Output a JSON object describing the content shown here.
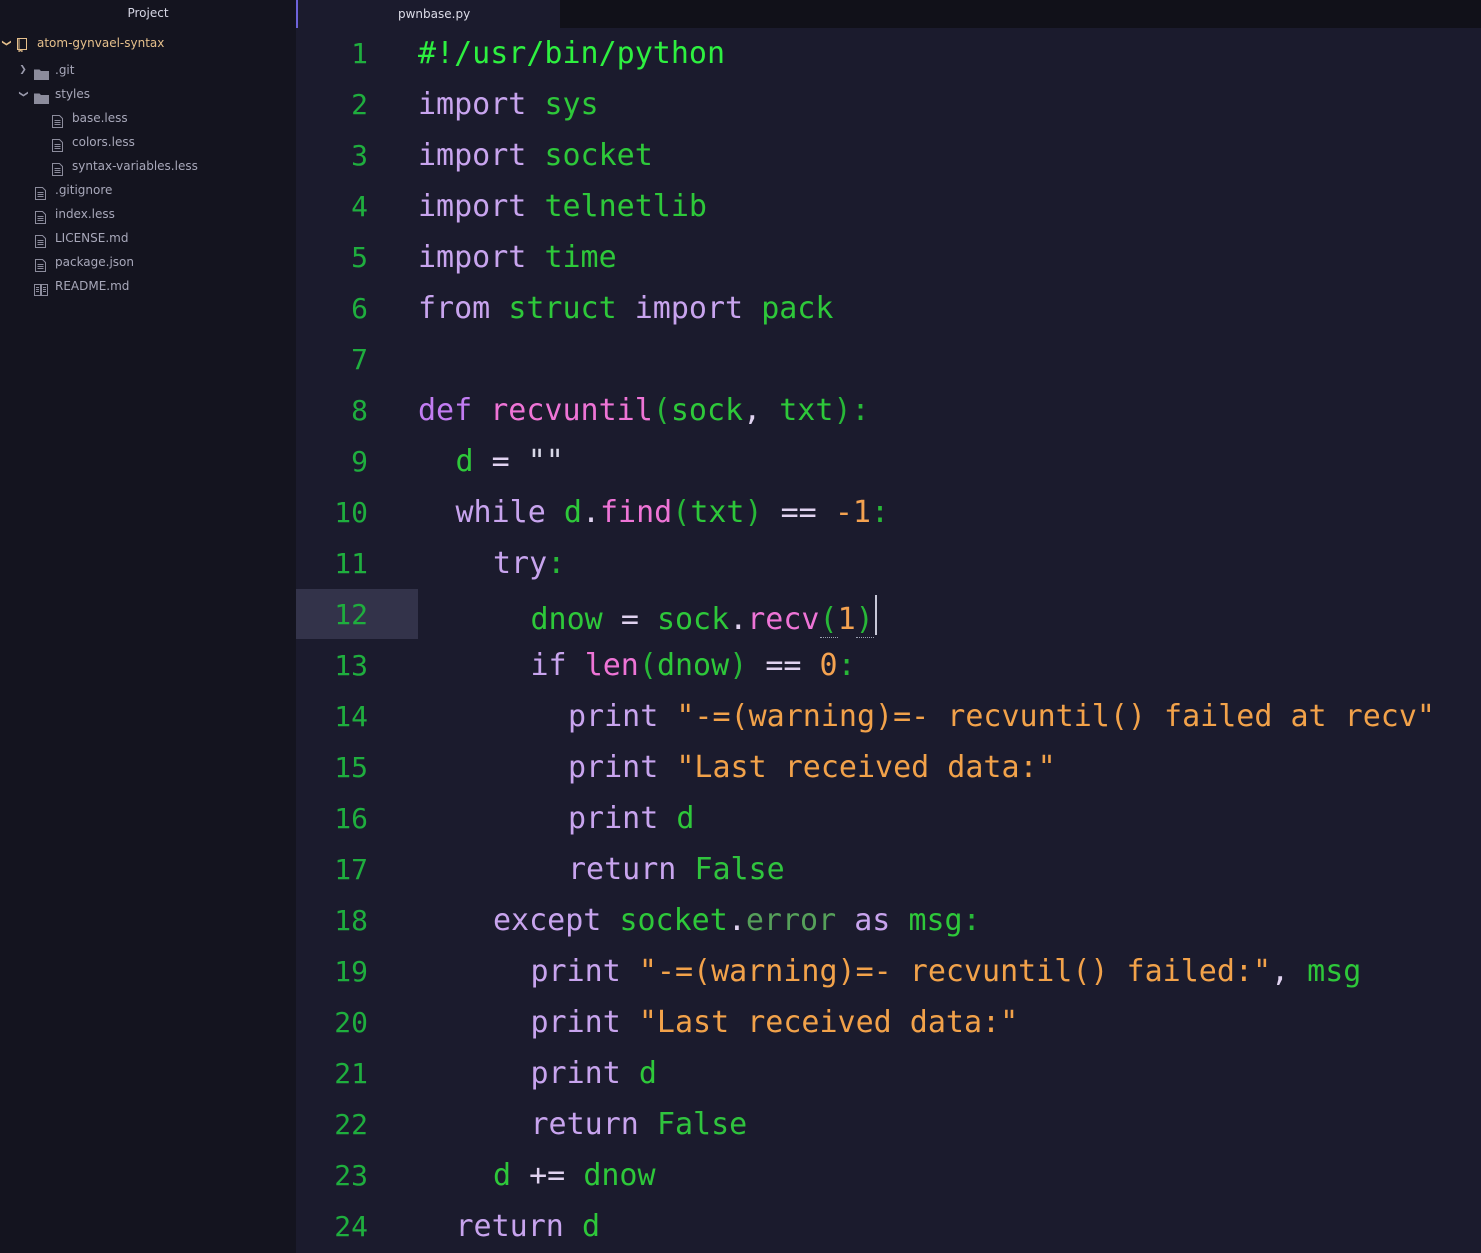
{
  "sidebar": {
    "title": "Project",
    "root": {
      "label": "atom-gynvael-syntax",
      "icon": "repo-icon",
      "expanded": true
    },
    "items": [
      {
        "label": ".git",
        "type": "folder",
        "depth": 1,
        "expanded": false
      },
      {
        "label": "styles",
        "type": "folder",
        "depth": 1,
        "expanded": true
      },
      {
        "label": "base.less",
        "type": "file",
        "depth": 2
      },
      {
        "label": "colors.less",
        "type": "file",
        "depth": 2
      },
      {
        "label": "syntax-variables.less",
        "type": "file",
        "depth": 2
      },
      {
        "label": ".gitignore",
        "type": "file",
        "depth": 1
      },
      {
        "label": "index.less",
        "type": "file",
        "depth": 1
      },
      {
        "label": "LICENSE.md",
        "type": "file",
        "depth": 1
      },
      {
        "label": "package.json",
        "type": "file",
        "depth": 1
      },
      {
        "label": "README.md",
        "type": "book",
        "depth": 1
      }
    ]
  },
  "editor": {
    "active_tab": "pwnbase.py",
    "cursor_line": 12,
    "lines": [
      {
        "n": "1",
        "indent": 0,
        "tokens": [
          [
            "she",
            "#!/usr/bin/python"
          ]
        ]
      },
      {
        "n": "2",
        "indent": 0,
        "tokens": [
          [
            "kw",
            "import"
          ],
          [
            "txt",
            " "
          ],
          [
            "id",
            "sys"
          ]
        ]
      },
      {
        "n": "3",
        "indent": 0,
        "tokens": [
          [
            "kw",
            "import"
          ],
          [
            "txt",
            " "
          ],
          [
            "id",
            "socket"
          ]
        ]
      },
      {
        "n": "4",
        "indent": 0,
        "tokens": [
          [
            "kw",
            "import"
          ],
          [
            "txt",
            " "
          ],
          [
            "id",
            "telnetlib"
          ]
        ]
      },
      {
        "n": "5",
        "indent": 0,
        "tokens": [
          [
            "kw",
            "import"
          ],
          [
            "txt",
            " "
          ],
          [
            "id",
            "time"
          ]
        ]
      },
      {
        "n": "6",
        "indent": 0,
        "tokens": [
          [
            "kw",
            "from"
          ],
          [
            "txt",
            " "
          ],
          [
            "id",
            "struct"
          ],
          [
            "txt",
            " "
          ],
          [
            "kw",
            "import"
          ],
          [
            "txt",
            " "
          ],
          [
            "id",
            "pack"
          ]
        ]
      },
      {
        "n": "7",
        "indent": 0,
        "tokens": []
      },
      {
        "n": "8",
        "indent": 0,
        "tokens": [
          [
            "kw2",
            "def"
          ],
          [
            "txt",
            " "
          ],
          [
            "fn",
            "recvuntil"
          ],
          [
            "pun",
            "("
          ],
          [
            "id",
            "sock"
          ],
          [
            "op",
            ","
          ],
          [
            "txt",
            " "
          ],
          [
            "id",
            "txt"
          ],
          [
            "pun",
            "):"
          ]
        ]
      },
      {
        "n": "9",
        "indent": 1,
        "tokens": [
          [
            "id",
            "d"
          ],
          [
            "txt",
            " "
          ],
          [
            "op",
            "="
          ],
          [
            "txt",
            " "
          ],
          [
            "txt",
            "\"\""
          ]
        ]
      },
      {
        "n": "10",
        "indent": 1,
        "tokens": [
          [
            "kw",
            "while"
          ],
          [
            "txt",
            " "
          ],
          [
            "id",
            "d"
          ],
          [
            "op",
            "."
          ],
          [
            "fn",
            "find"
          ],
          [
            "pun",
            "("
          ],
          [
            "id",
            "txt"
          ],
          [
            "pun",
            ")"
          ],
          [
            "txt",
            " "
          ],
          [
            "op",
            "=="
          ],
          [
            "txt",
            " "
          ],
          [
            "num",
            "-1"
          ],
          [
            "pun",
            ":"
          ]
        ]
      },
      {
        "n": "11",
        "indent": 2,
        "tokens": [
          [
            "kw",
            "try"
          ],
          [
            "pun",
            ":"
          ]
        ]
      },
      {
        "n": "12",
        "indent": 3,
        "tokens": [
          [
            "id",
            "dnow"
          ],
          [
            "txt",
            " "
          ],
          [
            "op",
            "="
          ],
          [
            "txt",
            " "
          ],
          [
            "id",
            "sock"
          ],
          [
            "op",
            "."
          ],
          [
            "fn",
            "recv"
          ],
          [
            "brk",
            "("
          ],
          [
            "num",
            "1"
          ],
          [
            "brk",
            ")"
          ]
        ]
      },
      {
        "n": "13",
        "indent": 3,
        "tokens": [
          [
            "kw",
            "if"
          ],
          [
            "txt",
            " "
          ],
          [
            "fn",
            "len"
          ],
          [
            "pun",
            "("
          ],
          [
            "id",
            "dnow"
          ],
          [
            "pun",
            ")"
          ],
          [
            "txt",
            " "
          ],
          [
            "op",
            "=="
          ],
          [
            "txt",
            " "
          ],
          [
            "num",
            "0"
          ],
          [
            "pun",
            ":"
          ]
        ]
      },
      {
        "n": "14",
        "indent": 4,
        "tokens": [
          [
            "kw",
            "print"
          ],
          [
            "txt",
            " "
          ],
          [
            "str",
            "\"-=(warning)=- recvuntil() failed at recv\""
          ]
        ]
      },
      {
        "n": "15",
        "indent": 4,
        "tokens": [
          [
            "kw",
            "print"
          ],
          [
            "txt",
            " "
          ],
          [
            "str",
            "\"Last received data:\""
          ]
        ]
      },
      {
        "n": "16",
        "indent": 4,
        "tokens": [
          [
            "kw",
            "print"
          ],
          [
            "txt",
            " "
          ],
          [
            "id",
            "d"
          ]
        ]
      },
      {
        "n": "17",
        "indent": 4,
        "tokens": [
          [
            "kw",
            "return"
          ],
          [
            "txt",
            " "
          ],
          [
            "bool",
            "False"
          ]
        ]
      },
      {
        "n": "18",
        "indent": 2,
        "tokens": [
          [
            "kw",
            "except"
          ],
          [
            "txt",
            " "
          ],
          [
            "id",
            "socket"
          ],
          [
            "op",
            "."
          ],
          [
            "mut",
            "error"
          ],
          [
            "txt",
            " "
          ],
          [
            "kw",
            "as"
          ],
          [
            "txt",
            " "
          ],
          [
            "id",
            "msg"
          ],
          [
            "pun",
            ":"
          ]
        ]
      },
      {
        "n": "19",
        "indent": 3,
        "tokens": [
          [
            "kw",
            "print"
          ],
          [
            "txt",
            " "
          ],
          [
            "str",
            "\"-=(warning)=- recvuntil() failed:\""
          ],
          [
            "op",
            ","
          ],
          [
            "txt",
            " "
          ],
          [
            "id",
            "msg"
          ]
        ]
      },
      {
        "n": "20",
        "indent": 3,
        "tokens": [
          [
            "kw",
            "print"
          ],
          [
            "txt",
            " "
          ],
          [
            "str",
            "\"Last received data:\""
          ]
        ]
      },
      {
        "n": "21",
        "indent": 3,
        "tokens": [
          [
            "kw",
            "print"
          ],
          [
            "txt",
            " "
          ],
          [
            "id",
            "d"
          ]
        ]
      },
      {
        "n": "22",
        "indent": 3,
        "tokens": [
          [
            "kw",
            "return"
          ],
          [
            "txt",
            " "
          ],
          [
            "bool",
            "False"
          ]
        ]
      },
      {
        "n": "23",
        "indent": 2,
        "tokens": [
          [
            "id",
            "d"
          ],
          [
            "txt",
            " "
          ],
          [
            "op",
            "+="
          ],
          [
            "txt",
            " "
          ],
          [
            "id",
            "dnow"
          ]
        ]
      },
      {
        "n": "24",
        "indent": 1,
        "tokens": [
          [
            "kw",
            "return"
          ],
          [
            "txt",
            " "
          ],
          [
            "id",
            "d"
          ]
        ]
      }
    ]
  },
  "colors": {
    "sidebar_bg": "#14141f",
    "editor_bg": "#1b1b2d",
    "tab_accent": "#6e63d9",
    "line_number": "#1fae3e",
    "cursor_line_bg": "#33334a"
  }
}
